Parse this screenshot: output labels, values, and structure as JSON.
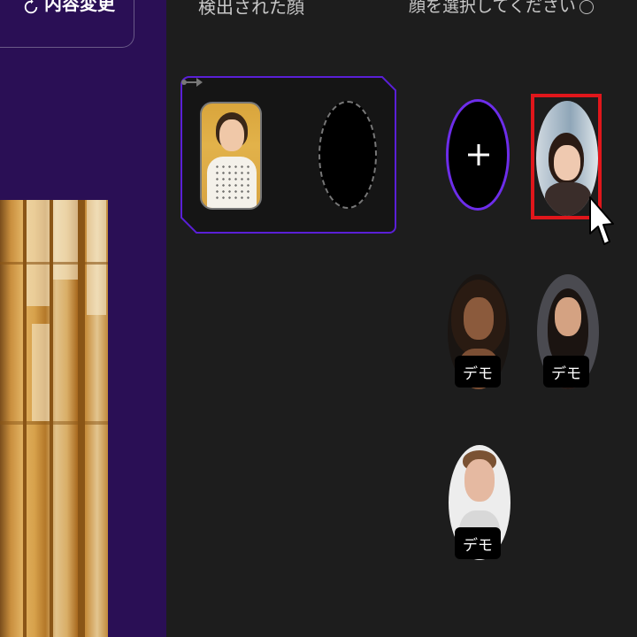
{
  "left_panel": {
    "change_button_label": "内容変更",
    "refresh_icon": "refresh-icon"
  },
  "main": {
    "detected_title": "検出された顔",
    "select_hint": "顔を選択してください",
    "info_icon": "info-icon",
    "arrow_icon": "arrow-right-icon",
    "plus_icon": "plus-icon",
    "cursor_icon": "mouse-pointer-icon"
  },
  "face_options": [
    {
      "badge": ""
    },
    {
      "badge": "デモ"
    },
    {
      "badge": "デモ"
    },
    {
      "badge": "デモ"
    }
  ],
  "colors": {
    "background": "#1d1d1d",
    "sidebar": "#2a0f55",
    "accent": "#6d2dea",
    "selected": "#e0161b"
  }
}
